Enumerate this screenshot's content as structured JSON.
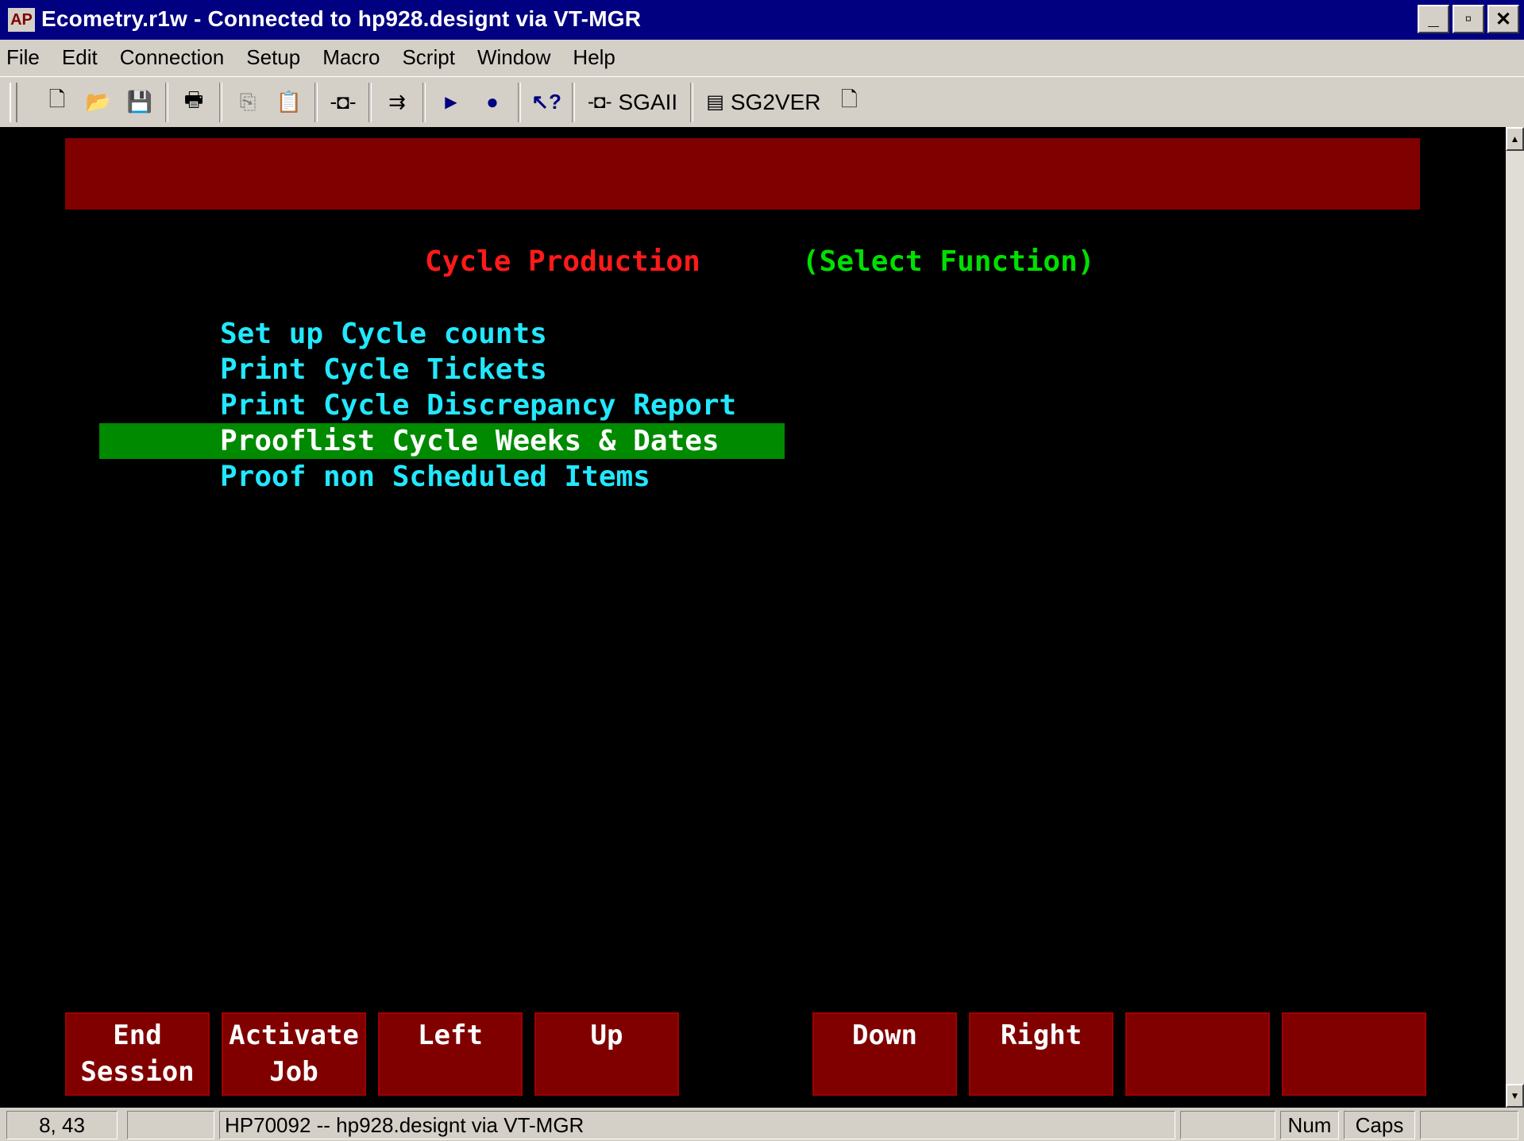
{
  "window": {
    "title": "Ecometry.r1w - Connected to hp928.designt via VT-MGR",
    "app_icon": "AP",
    "minimize": "_",
    "maximize": "▫",
    "close": "✕"
  },
  "menu": [
    "File",
    "Edit",
    "Connection",
    "Setup",
    "Macro",
    "Script",
    "Window",
    "Help"
  ],
  "toolbar": {
    "new": "🗋",
    "open": "📂",
    "save": "💾",
    "print": "🖶",
    "copy": "⎘",
    "paste": "📋",
    "connect": "-◘-",
    "send": "⇉",
    "play": "▶",
    "record": "●",
    "help": "↖?",
    "sgaii_label": "SGAII",
    "sg2ver_label": "SG2VER",
    "doc": "🗋"
  },
  "screen": {
    "title": "Cycle Production",
    "subtitle": "(Select Function)",
    "items": [
      "Set up Cycle counts",
      "Print Cycle Tickets",
      "Print Cycle Discrepancy Report",
      "Prooflist Cycle Weeks & Dates",
      "Proof non Scheduled Items"
    ],
    "selected_index": 3
  },
  "function_keys": [
    {
      "line1": "End",
      "line2": "Session"
    },
    {
      "line1": "Activate",
      "line2": "Job"
    },
    {
      "line1": "Left",
      "line2": ""
    },
    {
      "line1": "Up",
      "line2": ""
    },
    {
      "line1": "Down",
      "line2": ""
    },
    {
      "line1": "Right",
      "line2": ""
    },
    {
      "line1": "",
      "line2": ""
    },
    {
      "line1": "",
      "line2": ""
    }
  ],
  "status": {
    "cursor": "8, 43",
    "connection": "HP70092 -- hp928.designt via VT-MGR",
    "num": "Num",
    "caps": "Caps"
  },
  "colors": {
    "title_bar": "#000080",
    "banner": "#800000",
    "title_text": "#ff1a1a",
    "subtitle_text": "#00e000",
    "menu_text": "#22e8ff",
    "selection": "#008a00"
  }
}
